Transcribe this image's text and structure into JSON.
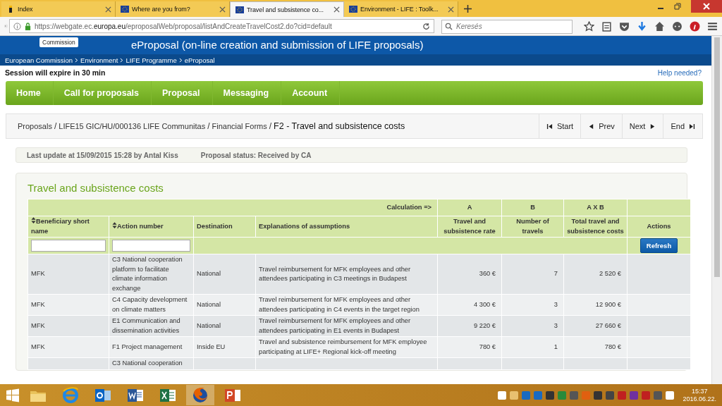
{
  "browser": {
    "tabs": [
      {
        "label": "Index",
        "selected": false
      },
      {
        "label": "Where are you from?",
        "selected": false
      },
      {
        "label": "Travel and subsistence co...",
        "selected": true
      },
      {
        "label": "Environment - LIFE : Toolk...",
        "selected": false
      }
    ],
    "url_parts": [
      "https://webgate.ec.",
      "europa.eu",
      "/eproposalWeb/proposal/listAndCreateTravelCost2.do?cid=default"
    ],
    "search": {
      "placeholder": "Keresés"
    }
  },
  "header": {
    "logo_label": "Commission",
    "title": "eProposal (on-line creation and submission of LIFE proposals)",
    "breadcrumb": [
      "European Commission",
      "Environment",
      "LIFE Programme",
      "eProposal"
    ]
  },
  "session": "Session will expire in 30 min",
  "help": "Help needed?",
  "menu": [
    "Home",
    "Call for proposals",
    "Proposal",
    "Messaging",
    "Account"
  ],
  "path_separator": "/",
  "path": [
    "Proposals",
    "LIFE15 GIC/HU/000136 LIFE Communitas",
    "Financial Forms",
    "F2 - Travel and subsistence costs"
  ],
  "pager": [
    {
      "label": "Start",
      "kind": "first"
    },
    {
      "label": "Prev",
      "kind": "prev"
    },
    {
      "label": "Next",
      "kind": "next"
    },
    {
      "label": "End",
      "kind": "last"
    }
  ],
  "info": {
    "last_update": "Last update at 15/09/2015 15:28 by Antal Kiss",
    "status": "Proposal status: Received by CA"
  },
  "section_title": "Travel and subsistence costs",
  "table": {
    "calc_label": "Calculation =>",
    "calc": [
      "A",
      "B",
      "A X B"
    ],
    "columns": [
      {
        "label": "Beneficiary short name",
        "sortable": true
      },
      {
        "label": "Action number",
        "sortable": true
      },
      {
        "label": "Destination",
        "sortable": false
      },
      {
        "label": "Explanations of assumptions",
        "sortable": false
      },
      {
        "label": "Travel and subsistence rate",
        "sortable": false
      },
      {
        "label": "Number of travels",
        "sortable": false
      },
      {
        "label": "Total travel and subsistence costs",
        "sortable": false
      },
      {
        "label": "Actions",
        "sortable": false
      }
    ],
    "refresh": "Refresh",
    "rows": [
      {
        "cells": [
          "MFK",
          "C3 National cooperation platform to facilitate climate information exchange",
          "National",
          "Travel reimbursement for MFK employees and other attendees participating in C3 meetings in Budapest",
          "360 €",
          "7",
          "2 520 €"
        ]
      },
      {
        "cells": [
          "MFK",
          "C4 Capacity development on climate matters",
          "National",
          "Travel reimbursement for MFK employees and other attendees participating in C4 events in the target region",
          "4 300 €",
          "3",
          "12 900 €"
        ]
      },
      {
        "cells": [
          "MFK",
          "E1 Communication and dissemination activities",
          "National",
          "Travel reimbursement for MFK employees and other attendees participating in E1 events in Budapest",
          "9 220 €",
          "3",
          "27 660 €"
        ]
      },
      {
        "cells": [
          "MFK",
          "F1 Project management",
          "Inside EU",
          "Travel and subsistence reimbursement for MFK employee participating at LIFE+ Regional kick-off meeting",
          "780 €",
          "1",
          "780 €"
        ]
      },
      {
        "cells": [
          "",
          "C3 National cooperation",
          "",
          "",
          "",
          "",
          ""
        ]
      }
    ]
  },
  "taskbar": {
    "time": "15:37",
    "date": "2016.06.22."
  }
}
